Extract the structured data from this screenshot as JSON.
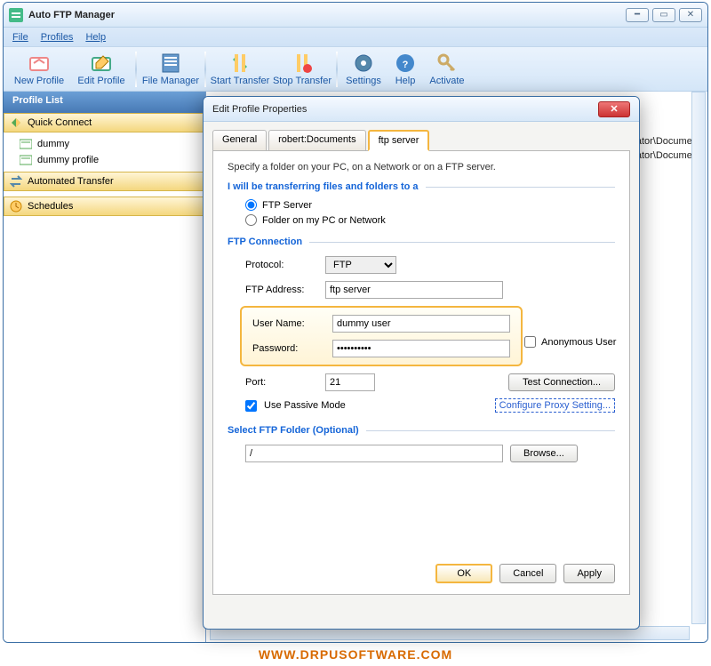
{
  "app": {
    "title": "Auto FTP Manager"
  },
  "menu": {
    "file": "File",
    "profiles": "Profiles",
    "help": "Help"
  },
  "toolbar": {
    "new_profile": "New Profile",
    "edit_profile": "Edit Profile",
    "file_manager": "File Manager",
    "start_transfer": "Start Transfer",
    "stop_transfer": "Stop Transfer",
    "settings": "Settings",
    "help": "Help",
    "activate": "Activate"
  },
  "sidebar": {
    "header": "Profile List",
    "quick_connect": "Quick Connect",
    "automated_transfer": "Automated Transfer",
    "schedules": "Schedules",
    "items": [
      "dummy",
      "dummy profile"
    ]
  },
  "right": {
    "path1": "ninistrator\\Document",
    "path2": "ninistrator\\Document"
  },
  "dialog": {
    "title": "Edit Profile Properties",
    "tabs": {
      "general": "General",
      "docs": "robert:Documents",
      "ftp": "ftp server"
    },
    "hint": "Specify a folder on your PC, on a Network or on a  FTP server.",
    "group1": "I will be transferring files and folders to a",
    "radio_ftp": "FTP Server",
    "radio_folder": "Folder on my PC or Network",
    "group2": "FTP Connection",
    "protocol_label": "Protocol:",
    "protocol_value": "FTP",
    "address_label": "FTP Address:",
    "address_value": "ftp server",
    "user_label": "User Name:",
    "user_value": "dummy user",
    "pass_label": "Password:",
    "pass_value": "••••••••••",
    "anon_label": "Anonymous User",
    "port_label": "Port:",
    "port_value": "21",
    "test_btn": "Test Connection...",
    "passive_label": "Use Passive Mode",
    "proxy_link": "Configure Proxy Setting...",
    "group3": "Select FTP Folder (Optional)",
    "folder_value": "/",
    "browse_btn": "Browse...",
    "ok": "OK",
    "cancel": "Cancel",
    "apply": "Apply"
  },
  "footer": "WWW.DRPUSOFTWARE.COM"
}
